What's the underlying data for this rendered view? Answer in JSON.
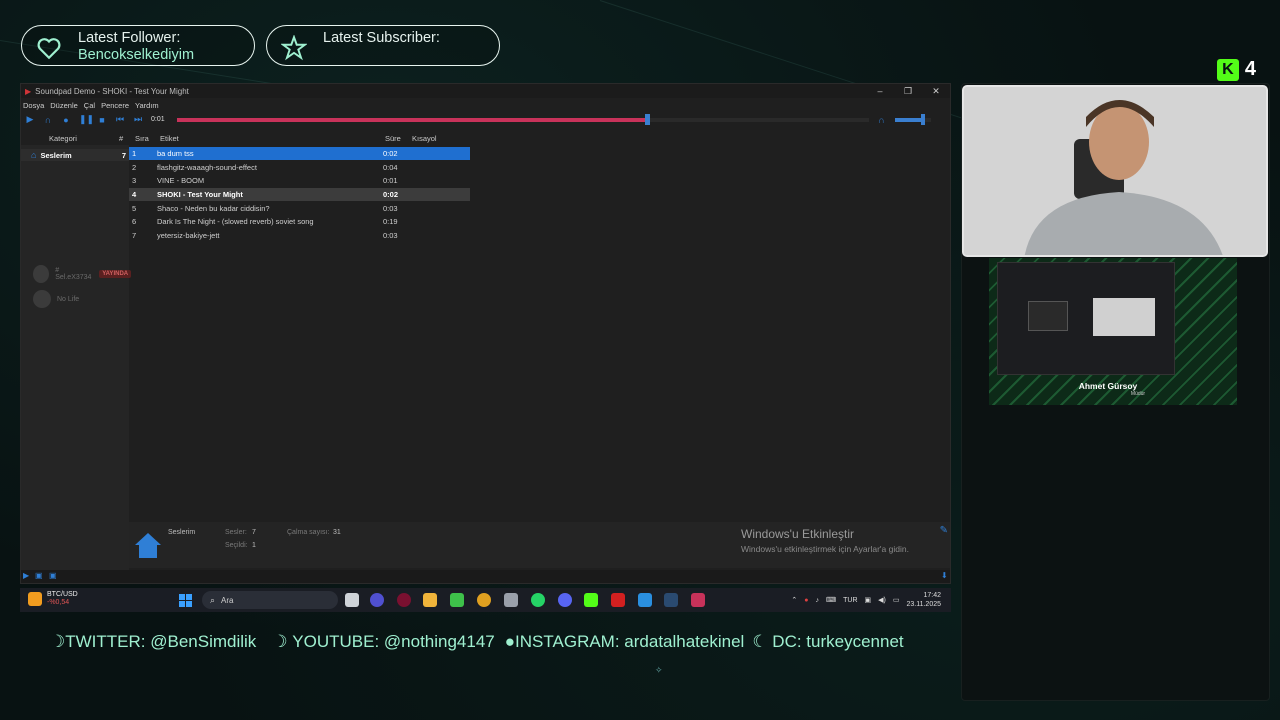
{
  "alerts": {
    "follower_label": "Latest Follower:",
    "follower_name": "Bencokselkediyim",
    "subscriber_label": "Latest Subscriber:",
    "subscriber_name": ""
  },
  "kick_count": "4",
  "soundpad": {
    "title": "Soundpad Demo - SHOKI - Test Your Might",
    "menu": [
      "Dosya",
      "Düzenle",
      "Çal",
      "Pencere",
      "Yardım"
    ],
    "time": "0:01",
    "progress_fraction": 0.68,
    "volume_fraction": 0.8,
    "columns": {
      "kategori": "Kategori",
      "hash": "#",
      "sira": "Sıra",
      "etiket": "Etiket",
      "sure": "Süre",
      "kisayol": "Kısayol"
    },
    "category": {
      "name": "Seslerim",
      "count": "7"
    },
    "users": [
      {
        "name": "# Sel.eX3734",
        "badge": "YAYINDA"
      },
      {
        "name": "No Life",
        "badge": ""
      }
    ],
    "sounds": [
      {
        "n": "1",
        "label": "ba dum tss",
        "dur": "0:02"
      },
      {
        "n": "2",
        "label": "flashgitz-waaagh-sound-effect",
        "dur": "0:04"
      },
      {
        "n": "3",
        "label": "VINE - BOOM",
        "dur": "0:01"
      },
      {
        "n": "4",
        "label": "SHOKI - Test Your Might",
        "dur": "0:02"
      },
      {
        "n": "5",
        "label": "Shaco - Neden bu kadar ciddisin?",
        "dur": "0:03"
      },
      {
        "n": "6",
        "label": "Dark Is The Night - (slowed reverb) soviet song",
        "dur": "0:19"
      },
      {
        "n": "7",
        "label": "yetersiz-bakiye-jett",
        "dur": "0:03"
      }
    ],
    "status": {
      "category": "Seslerim",
      "sesler_label": "Sesler:",
      "sesler_val": "7",
      "secildi_label": "Seçildi:",
      "secildi_val": "1",
      "calma_label": "Çalma sayısı:",
      "calma_val": "31"
    },
    "activation_title": "Windows'u Etkinleştir",
    "activation_sub": "Windows'u etkinleştirmek için Ayarlar'a gidin."
  },
  "taskbar": {
    "ticker": "BTC/USD",
    "ticker_change": "-%0,54",
    "search": "Ara",
    "lang": "TUR",
    "time": "17:42",
    "date": "23.11.2025"
  },
  "social": {
    "twitter": "TWITTER: @BenSimdilik",
    "youtube": "YOUTUBE: @nothing4147",
    "instagram": "INSTAGRAM: ardatalhatekinel",
    "discord": "DC: turkeycennet"
  },
  "preview": {
    "name": "Ahmet Gürsoy",
    "role": "Müdür"
  },
  "colors": {
    "accent": "#9ff0d0",
    "selection": "#1f6fd0",
    "progress": "#c8325a",
    "kick": "#53fc18"
  }
}
